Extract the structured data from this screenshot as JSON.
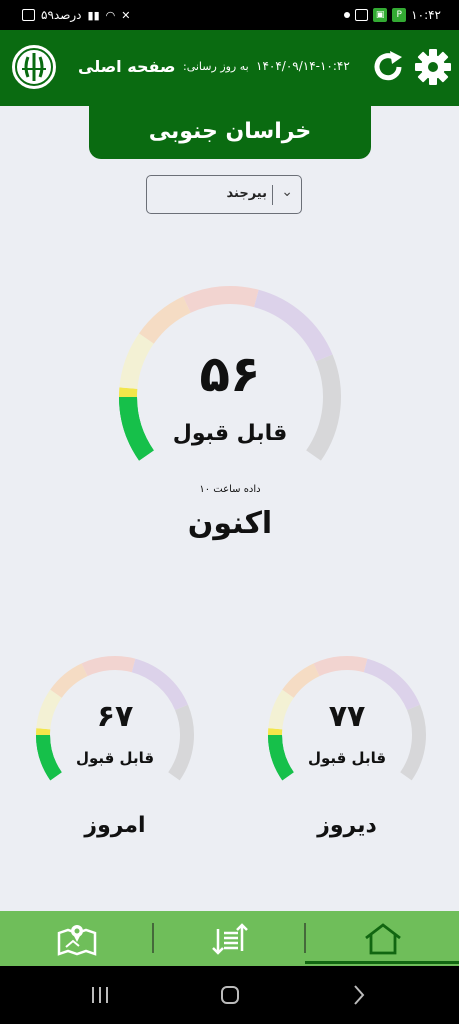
{
  "status_bar": {
    "time": "۱۰:۴۲",
    "battery": "۵۹درصد"
  },
  "header": {
    "title": "صفحه اصلی",
    "update_label": "به روز رسانی:",
    "update_time": "۱۴۰۴/۰۹/۱۴-۱۰:۴۲",
    "icons": [
      "logo",
      "refresh-icon",
      "gear-icon"
    ]
  },
  "province": "خراسان جنوبی",
  "city_select": {
    "selected": "بیرجند"
  },
  "gauges": {
    "now": {
      "value": "۵۶",
      "fraction": 0.56,
      "status": "قابل قبول",
      "note": "داده ساعت ۱۰",
      "label": "اکنون"
    },
    "yesterday": {
      "value": "۷۷",
      "fraction": 0.77,
      "status": "قابل قبول",
      "label": "دیروز"
    },
    "today": {
      "value": "۶۷",
      "fraction": 0.67,
      "status": "قابل قبول",
      "label": "امروز"
    }
  },
  "colors": {
    "header_green": "#0a6b11",
    "nav_green": "#6fbe5a",
    "gauge_green": "#16c04a",
    "gauge_yellow": "#f3e64a",
    "gauge_pale_yellow": "#f3f1d4",
    "gauge_peach": "#f5dcc4",
    "gauge_pink": "#f2d4d0",
    "gauge_lavender": "#dcd2ea",
    "gauge_gray": "#d7d7d9"
  },
  "bottom_nav": {
    "items": [
      "map-icon",
      "sort-icon",
      "home-icon"
    ],
    "active": "home-icon"
  }
}
